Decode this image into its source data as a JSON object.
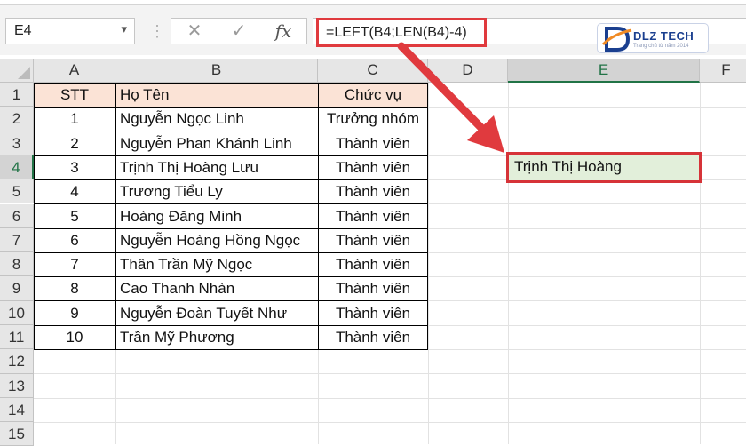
{
  "name_box": {
    "value": "E4"
  },
  "formula_bar": {
    "cancel_icon": "✕",
    "enter_icon": "✓",
    "fx_label": "fx",
    "formula": "=LEFT(B4;LEN(B4)-4)"
  },
  "watermark": {
    "brand": "DLZ TECH",
    "tagline": "Trang chủ từ năm 2014"
  },
  "columns": [
    "A",
    "B",
    "C",
    "D",
    "E",
    "F"
  ],
  "rows": [
    "1",
    "2",
    "3",
    "4",
    "5",
    "6",
    "7",
    "8",
    "9",
    "10",
    "11",
    "12",
    "13",
    "14",
    "15"
  ],
  "table": {
    "headers": [
      "STT",
      "Họ Tên",
      "Chức vụ"
    ],
    "rows": [
      [
        "1",
        "Nguyễn Ngọc Linh",
        "Trưởng nhóm"
      ],
      [
        "2",
        "Nguyễn Phan Khánh Linh",
        "Thành viên"
      ],
      [
        "3",
        "Trịnh Thị Hoàng Lưu",
        "Thành viên"
      ],
      [
        "4",
        "Trương Tiểu Ly",
        "Thành viên"
      ],
      [
        "5",
        "Hoàng Đăng Minh",
        "Thành viên"
      ],
      [
        "6",
        "Nguyễn Hoàng Hồng Ngọc",
        "Thành viên"
      ],
      [
        "7",
        "Thân Trần Mỹ Ngọc",
        "Thành viên"
      ],
      [
        "8",
        "Cao Thanh Nhàn",
        "Thành viên"
      ],
      [
        "9",
        "Nguyễn Đoàn Tuyết Như",
        "Thành viên"
      ],
      [
        "10",
        "Trần Mỹ Phương",
        "Thành viên"
      ]
    ]
  },
  "selected_cell": {
    "ref": "E4",
    "value": "Trịnh Thị Hoàng"
  },
  "colors": {
    "header_fill": "#fbe3d6",
    "highlight": "#e03a3e",
    "selected_fill": "#e2efda",
    "excel_green": "#217346"
  }
}
